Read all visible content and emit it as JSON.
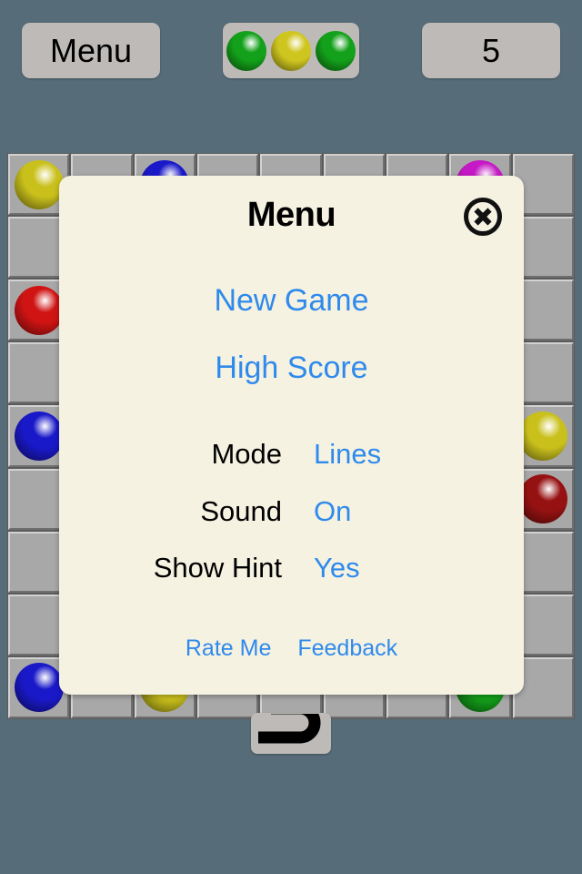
{
  "topbar": {
    "menu_button_label": "Menu",
    "score_value": "5",
    "next_balls": [
      {
        "name": "green-ball",
        "color": "#13a01a"
      },
      {
        "name": "yellow-ball",
        "color": "#cfc51f"
      },
      {
        "name": "green-ball",
        "color": "#13a01a"
      }
    ]
  },
  "board": {
    "rows": 9,
    "cols": 9,
    "cell_color": "#a8a8a8",
    "balls": [
      {
        "row": 0,
        "col": 0,
        "color": "#c9c01c",
        "name": "yellow-ball"
      },
      {
        "row": 0,
        "col": 2,
        "color": "#1a19c9",
        "name": "blue-ball"
      },
      {
        "row": 0,
        "col": 7,
        "color": "#c519c5",
        "name": "magenta-ball"
      },
      {
        "row": 2,
        "col": 0,
        "color": "#d01414",
        "name": "red-ball"
      },
      {
        "row": 4,
        "col": 0,
        "color": "#1a19c9",
        "name": "blue-ball"
      },
      {
        "row": 4,
        "col": 8,
        "color": "#c9c01c",
        "name": "yellow-ball"
      },
      {
        "row": 5,
        "col": 8,
        "color": "#961212",
        "name": "dark-red-ball"
      },
      {
        "row": 8,
        "col": 0,
        "color": "#1a19c9",
        "name": "blue-ball"
      },
      {
        "row": 8,
        "col": 2,
        "color": "#c9c01c",
        "name": "yellow-ball"
      },
      {
        "row": 8,
        "col": 7,
        "color": "#13a01a",
        "name": "green-ball"
      }
    ]
  },
  "undo": {
    "icon": "undo-arrow-icon"
  },
  "dialog": {
    "title": "Menu",
    "close_icon": "close-circle-icon",
    "new_game_label": "New Game",
    "high_score_label": "High Score",
    "settings": [
      {
        "label": "Mode",
        "value": "Lines"
      },
      {
        "label": "Sound",
        "value": "On"
      },
      {
        "label": "Show Hint",
        "value": "Yes"
      }
    ],
    "rate_me_label": "Rate Me",
    "feedback_label": "Feedback"
  },
  "colors": {
    "page_background": "#566c78",
    "dialog_background": "#f5f2e2",
    "button_face": "#bdbab7",
    "link_blue": "#2f8aeb"
  }
}
